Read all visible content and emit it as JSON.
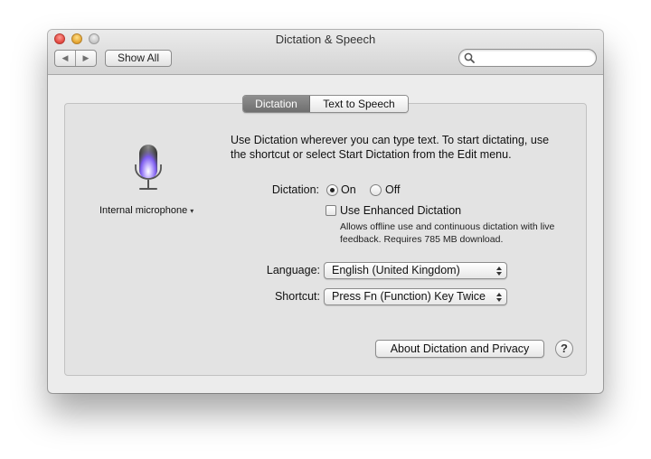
{
  "window": {
    "title": "Dictation & Speech"
  },
  "toolbar": {
    "back_glyph": "◀",
    "forward_glyph": "▶",
    "show_all_label": "Show All",
    "search_value": "",
    "search_placeholder": ""
  },
  "tabs": [
    {
      "label": "Dictation",
      "active": true
    },
    {
      "label": "Text to Speech",
      "active": false
    }
  ],
  "microphone": {
    "icon": "microphone-icon",
    "source": "Internal microphone",
    "menu_arrow": "▾"
  },
  "intro_text": "Use Dictation wherever you can type text. To start dictating, use the shortcut or select Start Dictation from the Edit menu.",
  "dictation": {
    "label": "Dictation:",
    "options": [
      {
        "label": "On",
        "selected": true
      },
      {
        "label": "Off",
        "selected": false
      }
    ]
  },
  "enhanced": {
    "label": "Use Enhanced Dictation",
    "checked": false,
    "note": "Allows offline use and continuous dictation with live feedback. Requires 785 MB download."
  },
  "language": {
    "label": "Language:",
    "value": "English (United Kingdom)"
  },
  "shortcut": {
    "label": "Shortcut:",
    "value": "Press Fn (Function) Key Twice"
  },
  "about_button": "About Dictation and Privacy",
  "help_button": "?",
  "colors": {
    "mic_glow": "#7d5cf0",
    "window_bg": "#ececec",
    "active_tab": "#7a7a7a"
  }
}
